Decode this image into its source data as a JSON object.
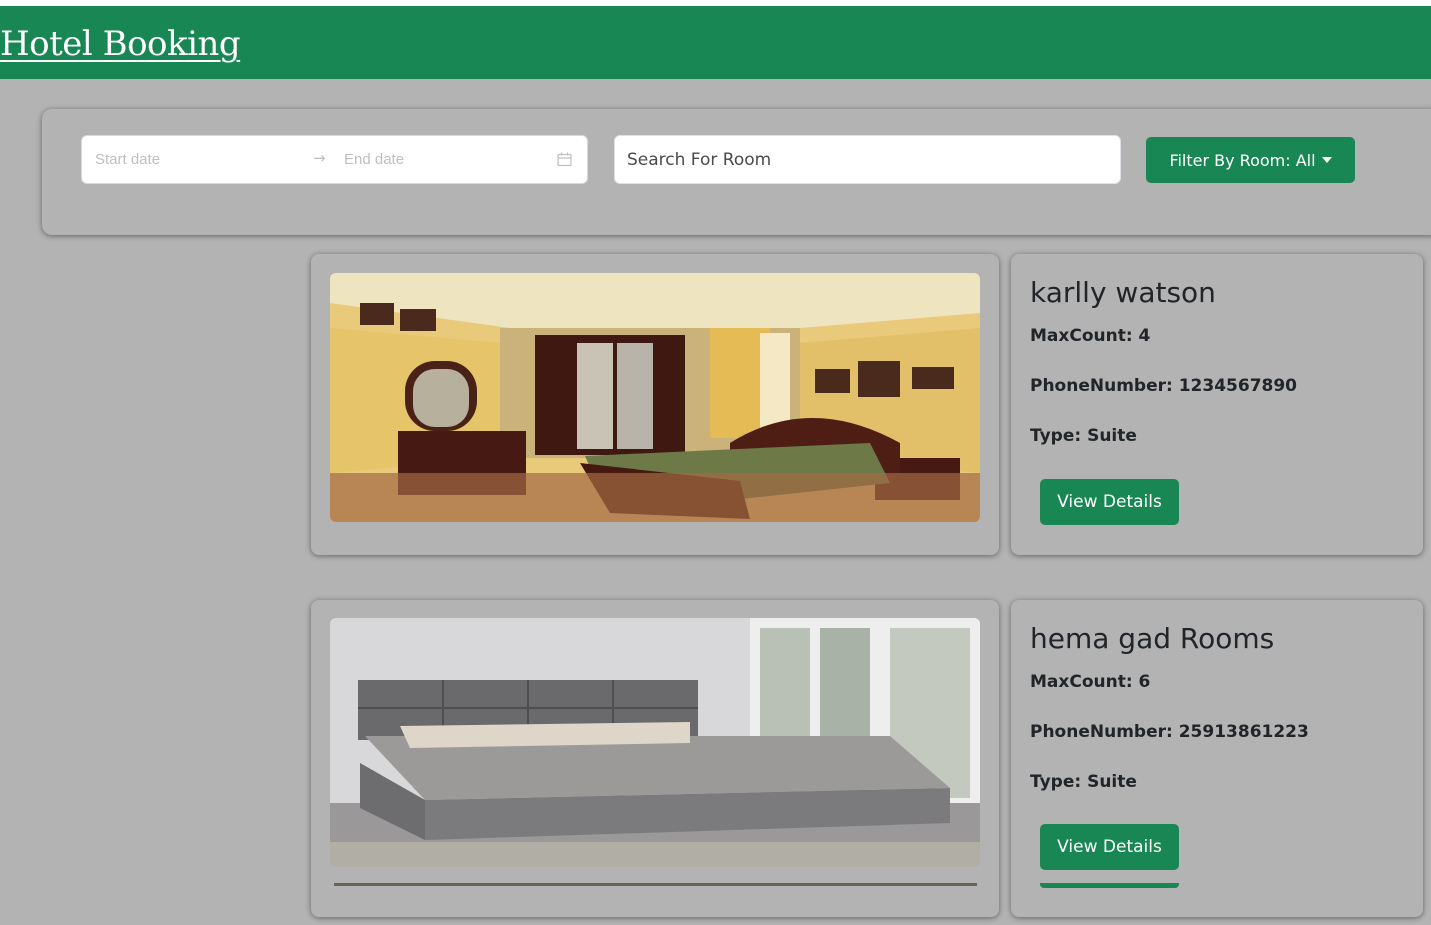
{
  "navbar": {
    "brand": "Hotel Booking",
    "color": "#198754"
  },
  "filters": {
    "start_date_placeholder": "Start date",
    "end_date_placeholder": "End date",
    "separator": "→",
    "search_placeholder": "Search For Room",
    "filter_button_label": "Filter By Room: All"
  },
  "rooms": [
    {
      "name": "karlly watson",
      "max_count": "MaxCount: 4",
      "phone": "PhoneNumber: 1234567890",
      "type": "Type: Suite",
      "button": "View Details",
      "image": "classic-yellow-bedroom"
    },
    {
      "name": "hema gad Rooms",
      "max_count": "MaxCount: 6",
      "phone": "PhoneNumber: 25913861223",
      "type": "Type: Suite",
      "button": "View Details",
      "image": "modern-grey-bedroom"
    }
  ]
}
